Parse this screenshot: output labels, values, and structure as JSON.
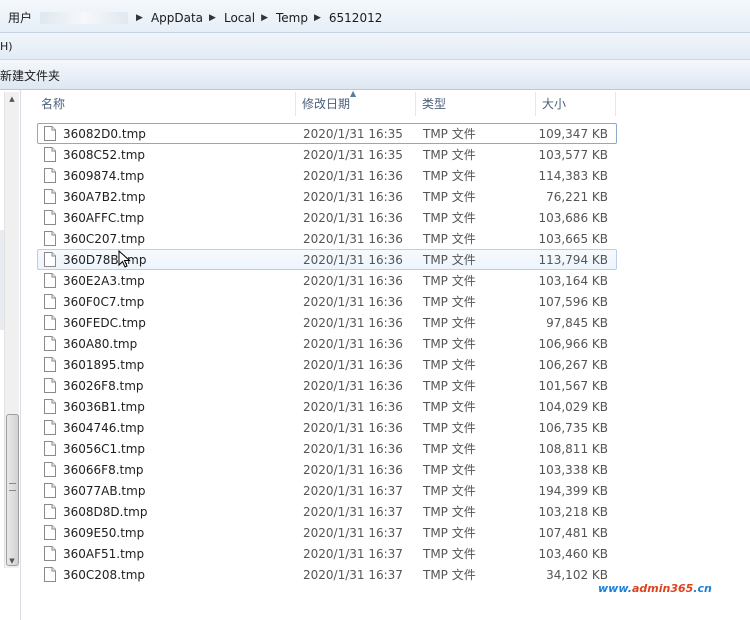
{
  "address": {
    "crumbs": [
      "用户",
      "AppData",
      "Local",
      "Temp",
      "6512012"
    ]
  },
  "menubar": {
    "item": "H)"
  },
  "toolbar": {
    "new_folder": "新建文件夹"
  },
  "columns": {
    "name": "名称",
    "date": "修改日期",
    "type": "类型",
    "size": "大小"
  },
  "files": [
    {
      "name": "36082D0.tmp",
      "date": "2020/1/31 16:35",
      "type": "TMP 文件",
      "size": "109,347 KB"
    },
    {
      "name": "3608C52.tmp",
      "date": "2020/1/31 16:35",
      "type": "TMP 文件",
      "size": "103,577 KB"
    },
    {
      "name": "3609874.tmp",
      "date": "2020/1/31 16:36",
      "type": "TMP 文件",
      "size": "114,383 KB"
    },
    {
      "name": "360A7B2.tmp",
      "date": "2020/1/31 16:36",
      "type": "TMP 文件",
      "size": "76,221 KB"
    },
    {
      "name": "360AFFC.tmp",
      "date": "2020/1/31 16:36",
      "type": "TMP 文件",
      "size": "103,686 KB"
    },
    {
      "name": "360C207.tmp",
      "date": "2020/1/31 16:36",
      "type": "TMP 文件",
      "size": "103,665 KB"
    },
    {
      "name": "360D78B.tmp",
      "date": "2020/1/31 16:36",
      "type": "TMP 文件",
      "size": "113,794 KB"
    },
    {
      "name": "360E2A3.tmp",
      "date": "2020/1/31 16:36",
      "type": "TMP 文件",
      "size": "103,164 KB"
    },
    {
      "name": "360F0C7.tmp",
      "date": "2020/1/31 16:36",
      "type": "TMP 文件",
      "size": "107,596 KB"
    },
    {
      "name": "360FEDC.tmp",
      "date": "2020/1/31 16:36",
      "type": "TMP 文件",
      "size": "97,845 KB"
    },
    {
      "name": "360A80.tmp",
      "date": "2020/1/31 16:36",
      "type": "TMP 文件",
      "size": "106,966 KB"
    },
    {
      "name": "3601895.tmp",
      "date": "2020/1/31 16:36",
      "type": "TMP 文件",
      "size": "106,267 KB"
    },
    {
      "name": "36026F8.tmp",
      "date": "2020/1/31 16:36",
      "type": "TMP 文件",
      "size": "101,567 KB"
    },
    {
      "name": "36036B1.tmp",
      "date": "2020/1/31 16:36",
      "type": "TMP 文件",
      "size": "104,029 KB"
    },
    {
      "name": "3604746.tmp",
      "date": "2020/1/31 16:36",
      "type": "TMP 文件",
      "size": "106,735 KB"
    },
    {
      "name": "36056C1.tmp",
      "date": "2020/1/31 16:36",
      "type": "TMP 文件",
      "size": "108,811 KB"
    },
    {
      "name": "36066F8.tmp",
      "date": "2020/1/31 16:36",
      "type": "TMP 文件",
      "size": "103,338 KB"
    },
    {
      "name": "36077AB.tmp",
      "date": "2020/1/31 16:37",
      "type": "TMP 文件",
      "size": "194,399 KB"
    },
    {
      "name": "3608D8D.tmp",
      "date": "2020/1/31 16:37",
      "type": "TMP 文件",
      "size": "103,218 KB"
    },
    {
      "name": "3609E50.tmp",
      "date": "2020/1/31 16:37",
      "type": "TMP 文件",
      "size": "107,481 KB"
    },
    {
      "name": "360AF51.tmp",
      "date": "2020/1/31 16:37",
      "type": "TMP 文件",
      "size": "103,460 KB"
    },
    {
      "name": "360C208.tmp",
      "date": "2020/1/31 16:37",
      "type": "TMP 文件",
      "size": "34,102 KB"
    }
  ],
  "watermark": {
    "part1": "www.",
    "part2": "admin365",
    "part3": ".cn"
  }
}
